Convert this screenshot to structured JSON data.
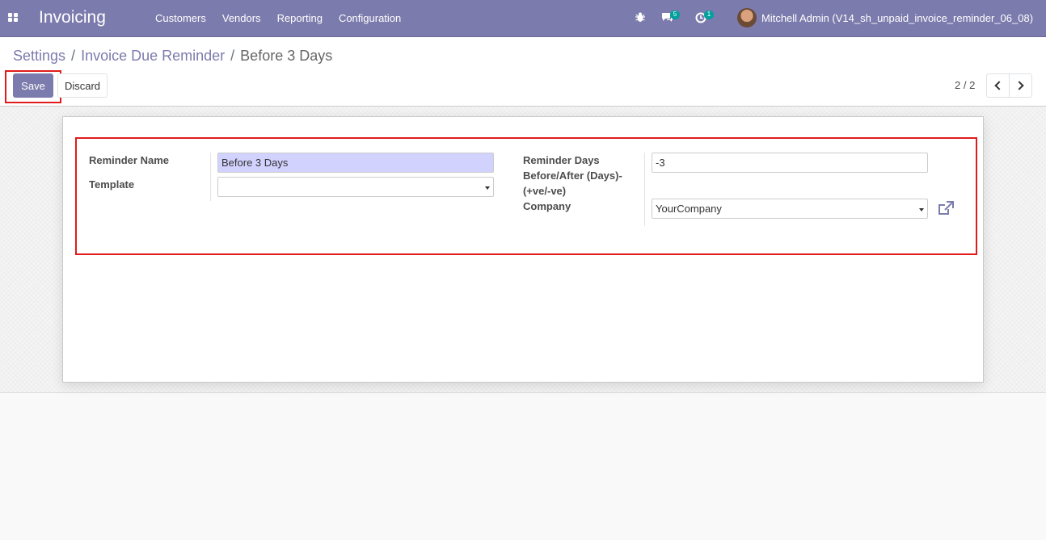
{
  "navbar": {
    "app_name": "Invoicing",
    "menu": [
      "Customers",
      "Vendors",
      "Reporting",
      "Configuration"
    ],
    "messages_count": "5",
    "activities_count": "1",
    "user_name": "Mitchell Admin (V14_sh_unpaid_invoice_reminder_06_08)"
  },
  "breadcrumb": {
    "items": [
      "Settings",
      "Invoice Due Reminder"
    ],
    "separator": "/",
    "current": "Before 3 Days"
  },
  "buttons": {
    "save": "Save",
    "discard": "Discard"
  },
  "pager": {
    "value": "2 / 2"
  },
  "form": {
    "reminder_name_label": "Reminder Name",
    "reminder_name_value": "Before 3 Days",
    "template_label": "Template",
    "template_value": "",
    "reminder_days_label_1": "Reminder Days",
    "reminder_days_label_2": "Before/After (Days)-",
    "reminder_days_label_3": "(+ve/-ve)",
    "reminder_days_value": "-3",
    "company_label": "Company",
    "company_value": "YourCompany"
  },
  "colors": {
    "brand": "#7c7bad",
    "highlight": "#e01b1b",
    "focused_input": "#d2d2ff",
    "badge": "#00a09d"
  }
}
